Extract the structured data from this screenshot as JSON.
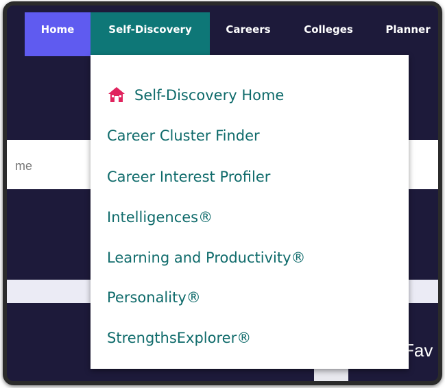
{
  "nav": {
    "items": [
      {
        "label": "Home"
      },
      {
        "label": "Self-Discovery"
      },
      {
        "label": "Careers"
      },
      {
        "label": "Colleges"
      },
      {
        "label": "Planner"
      }
    ]
  },
  "dropdown": {
    "items": [
      {
        "label": "Self-Discovery Home",
        "icon": "home-icon"
      },
      {
        "label": "Career Cluster Finder"
      },
      {
        "label": "Career Interest Profiler"
      },
      {
        "label": "Intelligences®"
      },
      {
        "label": "Learning and Productivity®"
      },
      {
        "label": "Personality®"
      },
      {
        "label": "StrengthsExplorer®"
      }
    ]
  },
  "background": {
    "search_partial": "me",
    "heading_partial": "Fav"
  },
  "colors": {
    "nav_bg": "#1d1a3a",
    "home_active": "#5f5bf0",
    "self_active": "#0e7777",
    "link": "#0f6b6b",
    "home_icon": "#e0245e"
  }
}
